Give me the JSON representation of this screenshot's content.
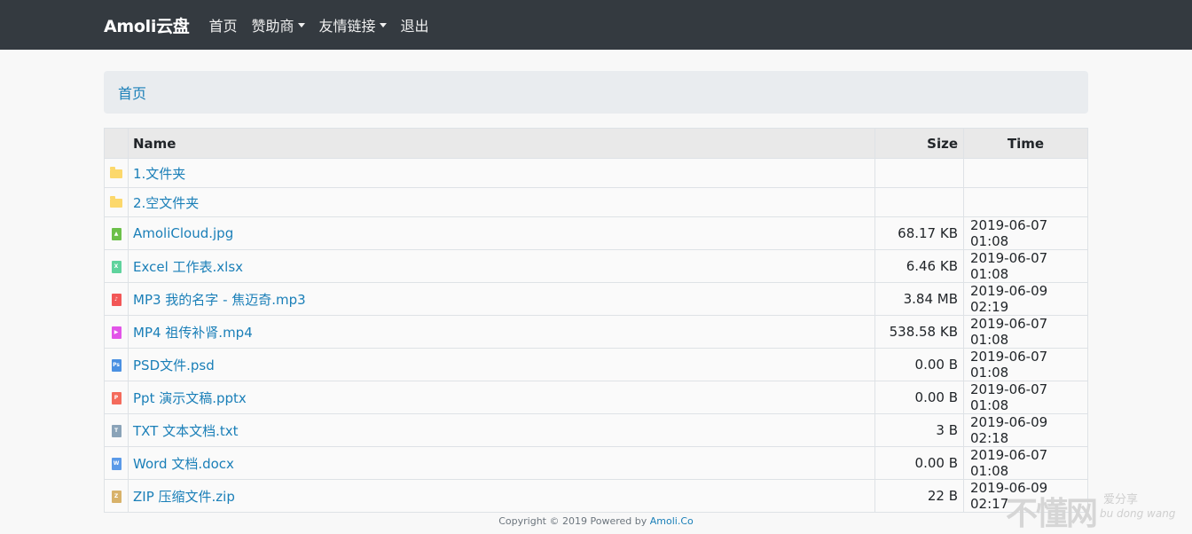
{
  "navbar": {
    "brand": "Amoli云盘",
    "items": [
      {
        "label": "首页",
        "dropdown": false
      },
      {
        "label": "赞助商",
        "dropdown": true
      },
      {
        "label": "友情链接",
        "dropdown": true
      },
      {
        "label": "退出",
        "dropdown": false
      }
    ]
  },
  "breadcrumb": {
    "label": "首页"
  },
  "table": {
    "headers": {
      "name": "Name",
      "size": "Size",
      "time": "Time"
    },
    "rows": [
      {
        "name": "1.文件夹",
        "size": "",
        "time": "",
        "icon": "folder-icon",
        "color": "#fcd86b"
      },
      {
        "name": "2.空文件夹",
        "size": "",
        "time": "",
        "icon": "folder-icon",
        "color": "#fcd86b"
      },
      {
        "name": "AmoliCloud.jpg",
        "size": "68.17 KB",
        "time": "2019-06-07 01:08",
        "icon": "image-file-icon",
        "color": "#6cc04a",
        "glyph": "▲"
      },
      {
        "name": "Excel 工作表.xlsx",
        "size": "6.46 KB",
        "time": "2019-06-07 01:08",
        "icon": "excel-file-icon",
        "color": "#5fd39d",
        "glyph": "X"
      },
      {
        "name": "MP3 我的名字 - 焦迈奇.mp3",
        "size": "3.84 MB",
        "time": "2019-06-09 02:19",
        "icon": "audio-file-icon",
        "color": "#f25757",
        "glyph": "♪"
      },
      {
        "name": "MP4 祖传补肾.mp4",
        "size": "538.58 KB",
        "time": "2019-06-07 01:08",
        "icon": "video-file-icon",
        "color": "#e254e8",
        "glyph": "▶"
      },
      {
        "name": "PSD文件.psd",
        "size": "0.00 B",
        "time": "2019-06-07 01:08",
        "icon": "psd-file-icon",
        "color": "#4a90e2",
        "glyph": "Ps"
      },
      {
        "name": "Ppt 演示文稿.pptx",
        "size": "0.00 B",
        "time": "2019-06-07 01:08",
        "icon": "ppt-file-icon",
        "color": "#f46b5c",
        "glyph": "P"
      },
      {
        "name": "TXT 文本文档.txt",
        "size": "3 B",
        "time": "2019-06-09 02:18",
        "icon": "text-file-icon",
        "color": "#8aa3b8",
        "glyph": "T"
      },
      {
        "name": "Word 文档.docx",
        "size": "0.00 B",
        "time": "2019-06-07 01:08",
        "icon": "word-file-icon",
        "color": "#5b9ae8",
        "glyph": "W"
      },
      {
        "name": "ZIP 压缩文件.zip",
        "size": "22 B",
        "time": "2019-06-09 02:17",
        "icon": "zip-file-icon",
        "color": "#d8b26a",
        "glyph": "Z"
      }
    ]
  },
  "footer": {
    "text": "Copyright © 2019 Powered by ",
    "link": "Amoli.Co"
  },
  "watermark": {
    "main": "不懂网",
    "top": "爱分享",
    "bottom": "bu dong wang"
  }
}
